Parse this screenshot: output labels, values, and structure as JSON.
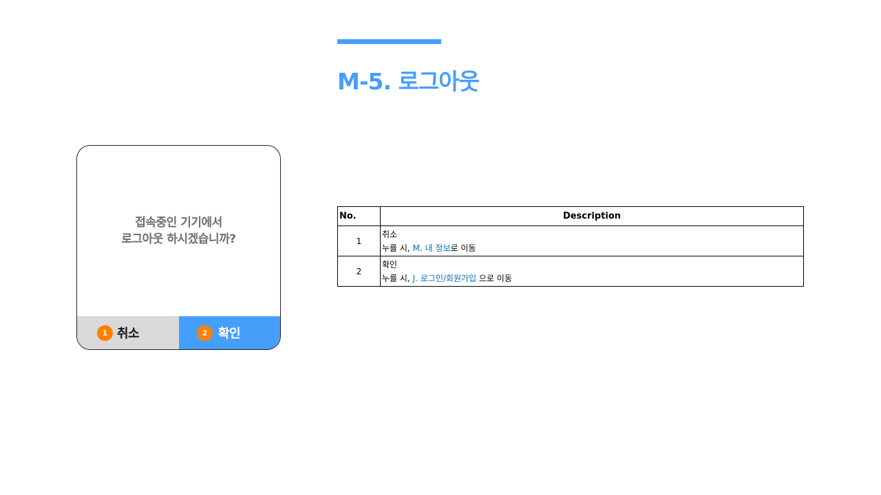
{
  "header": {
    "title": "M-5. 로그아웃",
    "accent_color": "#459ffa"
  },
  "dialog": {
    "message_line1": "접속중인 기기에서",
    "message_line2": "로그아웃 하시겠습니까?",
    "cancel": {
      "badge": "1",
      "label": "취소",
      "bg_color": "#d9d9d9"
    },
    "confirm": {
      "badge": "2",
      "label": "확인",
      "bg_color": "#459ffa"
    },
    "badge_color": "#ff7f00"
  },
  "table": {
    "headers": {
      "no": "No.",
      "description": "Description"
    },
    "rows": [
      {
        "no": "1",
        "title": "취소",
        "prefix": "누를 시, ",
        "link": "M. 내 정보",
        "suffix": "로 이동"
      },
      {
        "no": "2",
        "title": "확인",
        "prefix": "누를 시, ",
        "link": "J. 로그인/회원가입",
        "suffix": " 으로 이동"
      }
    ],
    "link_color": "#0070c0"
  }
}
